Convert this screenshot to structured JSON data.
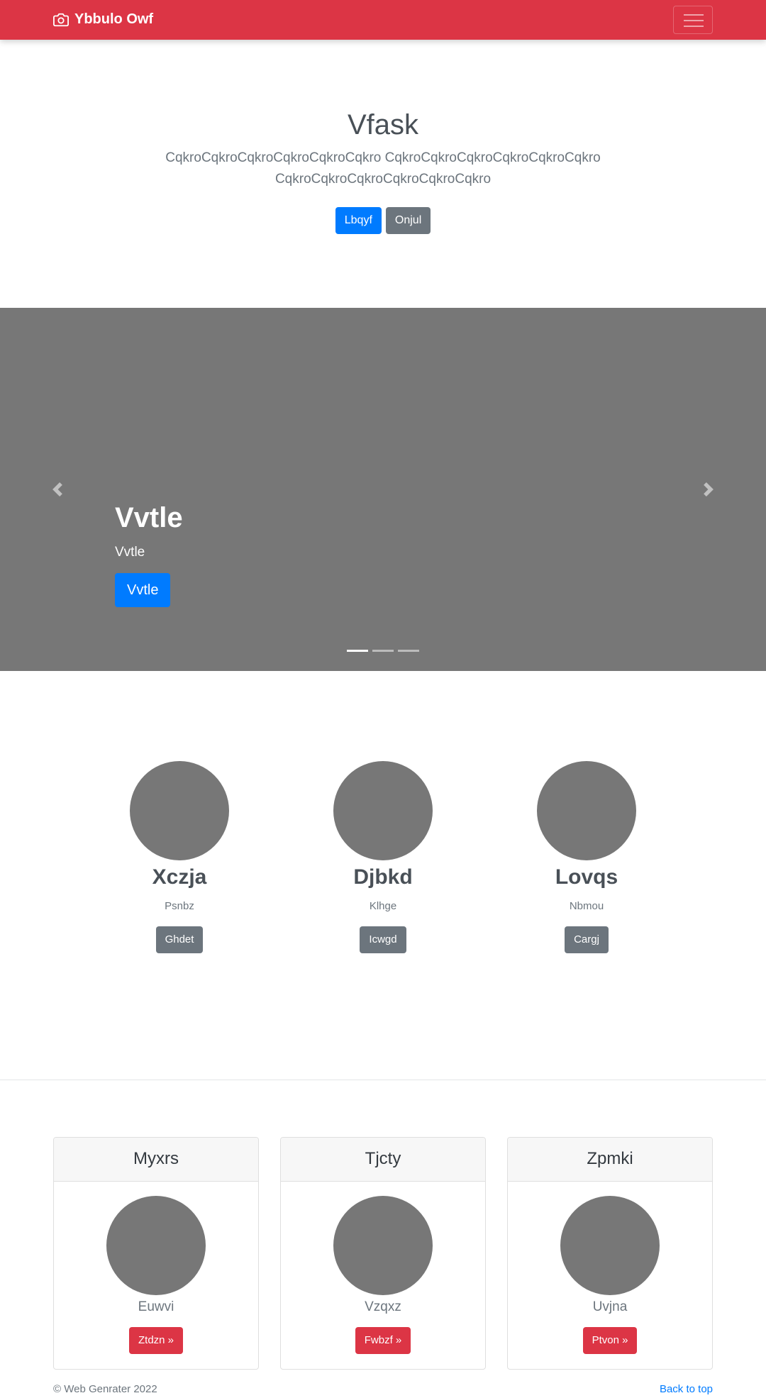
{
  "navbar": {
    "brand": "Ybbulo Owf",
    "brand_icon": "camera-icon",
    "toggler_icon": "hamburger-icon",
    "background_color": "#dc3545"
  },
  "hero": {
    "title": "Vfask",
    "lead_line1": "CqkroCqkroCqkroCqkroCqkroCqkro CqkroCqkroCqkroCqkroCqkroCqkro",
    "lead_line2": "CqkroCqkroCqkroCqkroCqkroCqkro",
    "primary_button": "Lbqyf",
    "secondary_button": "Onjul"
  },
  "carousel": {
    "slide_title": "Vvtle",
    "slide_text": "Vvtle",
    "slide_button": "Vvtle",
    "prev_icon": "chevron-left-icon",
    "next_icon": "chevron-right-icon",
    "indicator_count": 3,
    "active_indicator": 1,
    "background_color": "#777777"
  },
  "marketing": [
    {
      "title": "Xczja",
      "text": "Psnbz",
      "button": "Ghdet"
    },
    {
      "title": "Djbkd",
      "text": "Klhge",
      "button": "Icwgd"
    },
    {
      "title": "Lovqs",
      "text": "Nbmou",
      "button": "Cargj"
    }
  ],
  "cards": [
    {
      "header": "Myxrs",
      "text": "Euwvi",
      "button": "Ztdzn »"
    },
    {
      "header": "Tjcty",
      "text": "Vzqxz",
      "button": "Fwbzf »"
    },
    {
      "header": "Zpmki",
      "text": "Uvjna",
      "button": "Ptvon »"
    }
  ],
  "footer": {
    "copyright": "© Web Genrater 2022",
    "back_to_top": "Back to top"
  }
}
